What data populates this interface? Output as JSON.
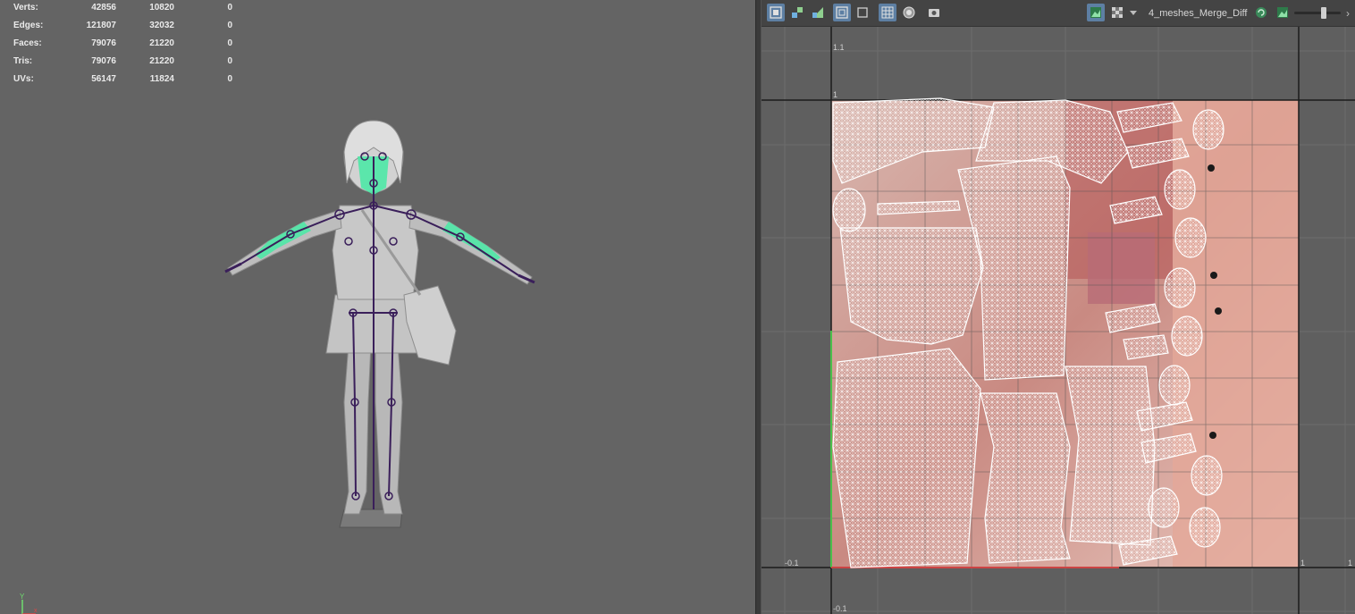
{
  "hud": {
    "rows": [
      {
        "label": "Verts:",
        "c1": "42856",
        "c2": "10820",
        "c3": "0"
      },
      {
        "label": "Edges:",
        "c1": "121807",
        "c2": "32032",
        "c3": "0"
      },
      {
        "label": "Faces:",
        "c1": "79076",
        "c2": "21220",
        "c3": "0"
      },
      {
        "label": "Tris:",
        "c1": "79076",
        "c2": "21220",
        "c3": "0"
      },
      {
        "label": "UVs:",
        "c1": "56147",
        "c2": "11824",
        "c3": "0"
      }
    ]
  },
  "axis": {
    "y_label": "Y"
  },
  "uv_editor": {
    "texture_name": "4_meshes_Merge_Diff",
    "grid_labels": {
      "top_v": "1.1",
      "one_v": "1",
      "neg_u": "-0.1",
      "one_u": "1",
      "right_u": "1",
      "neg_v": "-0.1"
    },
    "toolbar_icons": [
      "uv-shell-icon",
      "uv-move-icon",
      "uv-flip-icon",
      "frame-icon",
      "frame-selected-icon",
      "grid-icon",
      "shaded-icon",
      "snapshot-icon",
      "display-image-icon",
      "checker-icon",
      "texture-dropdown-icon",
      "refresh-icon",
      "image-icon"
    ]
  },
  "colors": {
    "viewport_bg": "#646464",
    "uv_bg": "#5f5f5f",
    "joint": "#3a1f5a",
    "skin_highlight": "#4ee8a6",
    "wire": "#ffffff"
  }
}
